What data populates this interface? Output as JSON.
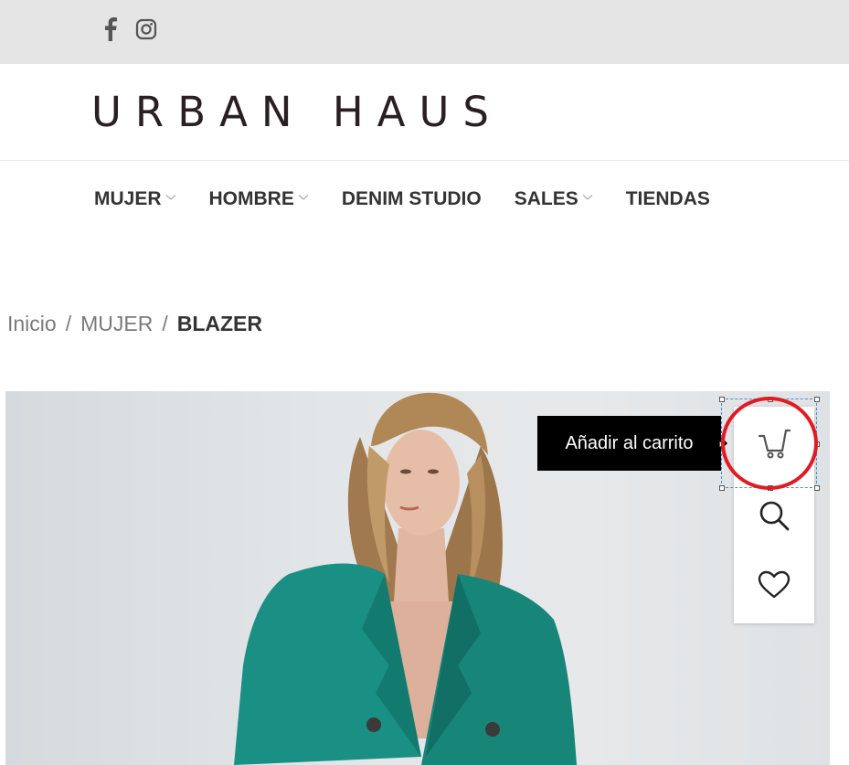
{
  "topbar": {
    "social": [
      {
        "icon": "facebook-icon"
      },
      {
        "icon": "instagram-icon"
      }
    ]
  },
  "header": {
    "logo": "URBAN HAUS"
  },
  "nav": {
    "items": [
      {
        "label": "MUJER",
        "has_dropdown": true
      },
      {
        "label": "HOMBRE",
        "has_dropdown": true
      },
      {
        "label": "DENIM STUDIO",
        "has_dropdown": false
      },
      {
        "label": "SALES",
        "has_dropdown": true
      },
      {
        "label": "TIENDAS",
        "has_dropdown": false
      }
    ]
  },
  "breadcrumb": {
    "home": "Inicio",
    "separator": "/",
    "category": "MUJER",
    "current": "BLAZER"
  },
  "product": {
    "tooltip": "Añadir al carrito",
    "actions": [
      "cart-icon",
      "search-icon",
      "heart-icon"
    ]
  },
  "colors": {
    "topbar_bg": "#e5e5e5",
    "logo": "#2a1f22",
    "tooltip_bg": "#000000",
    "highlight": "#e01b24",
    "blazer": "#1a8f83"
  }
}
